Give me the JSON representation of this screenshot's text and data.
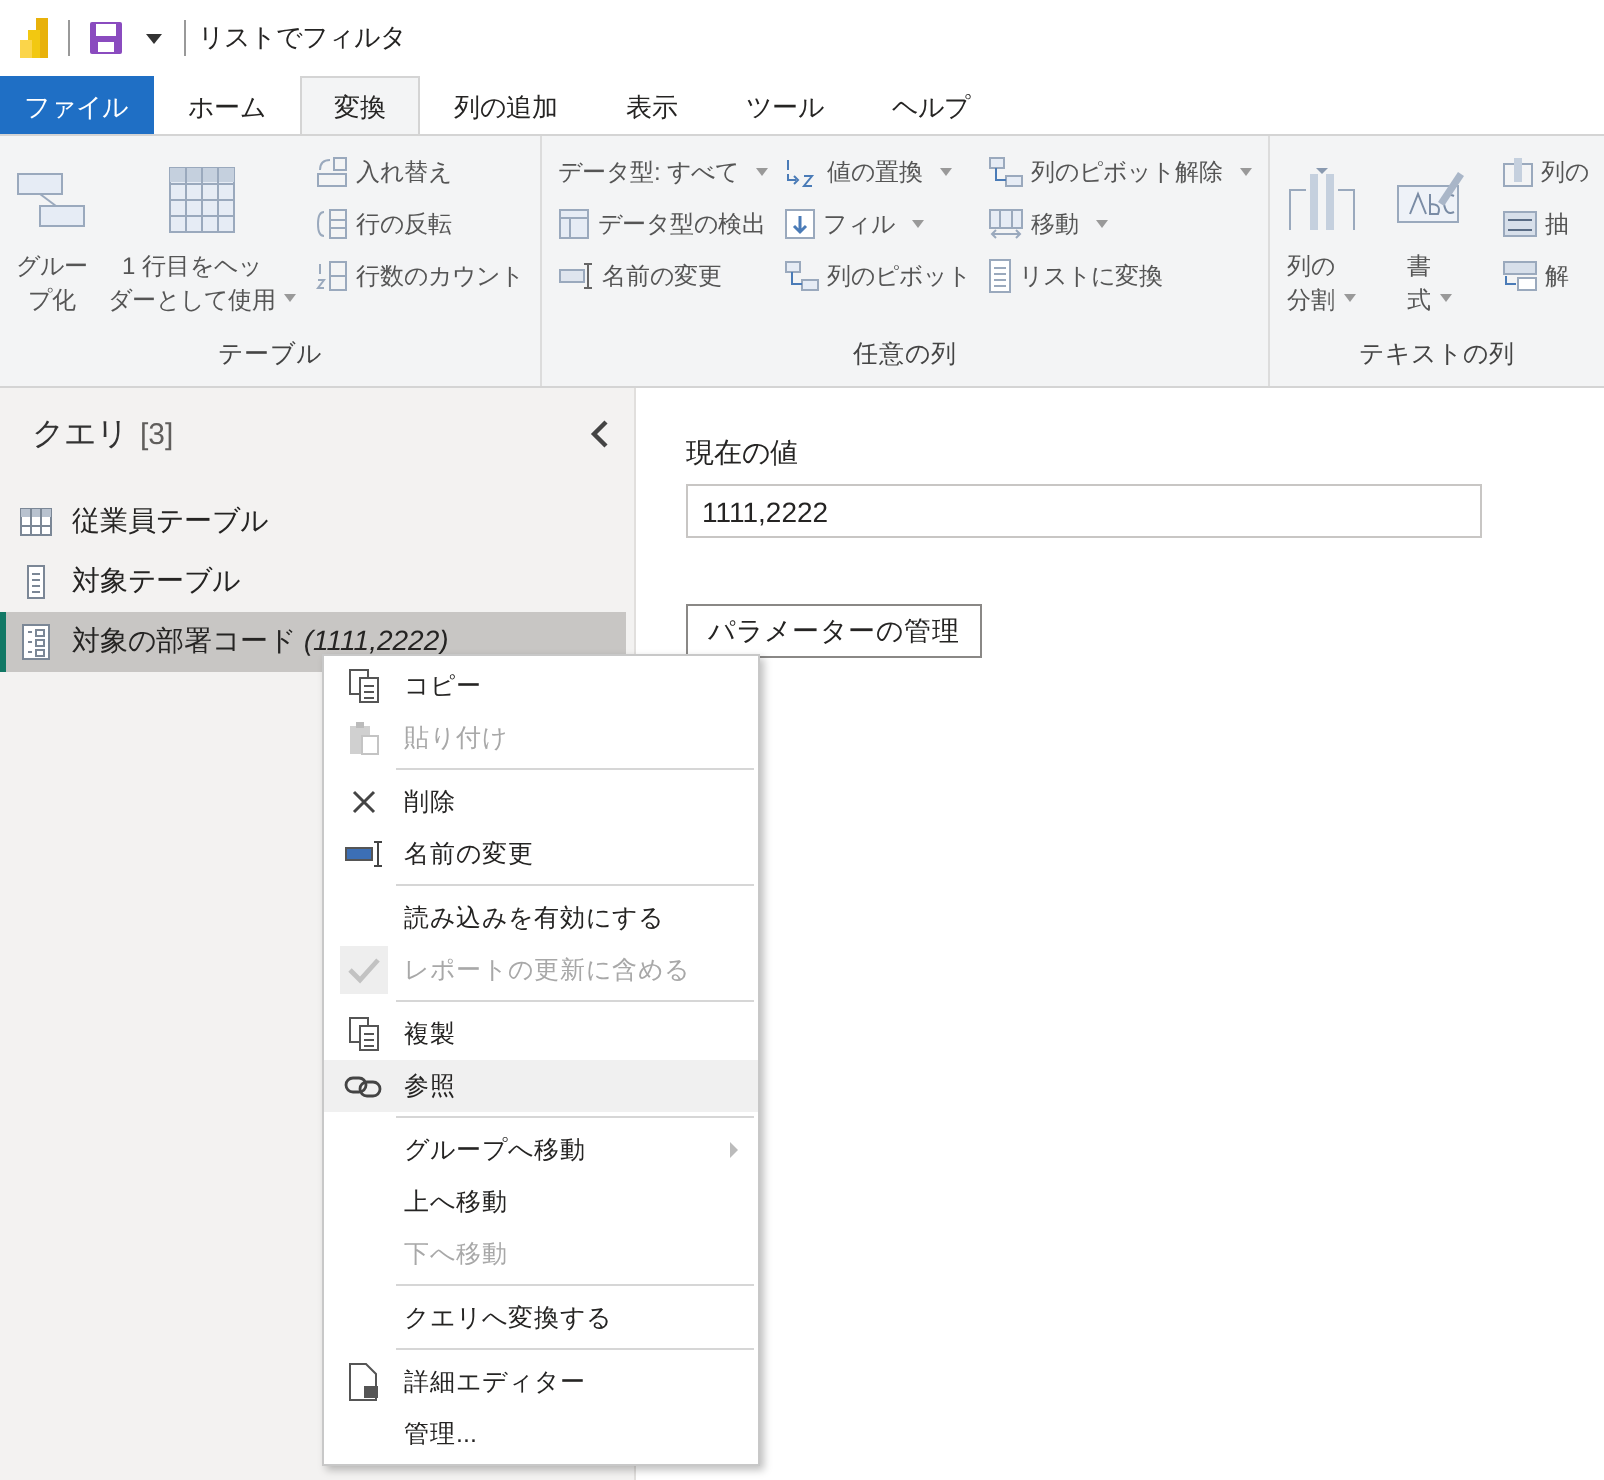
{
  "window": {
    "title": "リストでフィルタ"
  },
  "tabs": [
    {
      "label": "ファイル",
      "kind": "file",
      "selected": false
    },
    {
      "label": "ホーム",
      "kind": "tab",
      "selected": false
    },
    {
      "label": "変換",
      "kind": "tab",
      "selected": true
    },
    {
      "label": "列の追加",
      "kind": "tab",
      "selected": false
    },
    {
      "label": "表示",
      "kind": "tab",
      "selected": false
    },
    {
      "label": "ツール",
      "kind": "tab",
      "selected": false
    },
    {
      "label": "ヘルプ",
      "kind": "tab",
      "selected": false
    }
  ],
  "ribbon": {
    "groups": [
      {
        "label": "テーブル",
        "commands": [
          {
            "lines": [
              "グルー",
              "プ化"
            ],
            "kind": "large",
            "dropdown": false
          },
          {
            "lines": [
              "1 行目をヘッ",
              "ダーとして使用"
            ],
            "kind": "large",
            "dropdown": true
          },
          {
            "label": "入れ替え",
            "kind": "small",
            "dropdown": false
          },
          {
            "label": "行の反転",
            "kind": "small",
            "dropdown": false
          },
          {
            "label": "行数のカウント",
            "kind": "small",
            "dropdown": false
          }
        ]
      },
      {
        "label": "任意の列",
        "commands": [
          {
            "label": "データ型: すべて",
            "kind": "small",
            "dropdown": true
          },
          {
            "label": "データ型の検出",
            "kind": "small",
            "dropdown": false
          },
          {
            "label": "名前の変更",
            "kind": "small",
            "dropdown": false
          },
          {
            "label": "値の置換",
            "kind": "small",
            "dropdown": true
          },
          {
            "label": "フィル",
            "kind": "small",
            "dropdown": true
          },
          {
            "label": "列のピボット",
            "kind": "small",
            "dropdown": false
          },
          {
            "label": "列のピボット解除",
            "kind": "small",
            "dropdown": true
          },
          {
            "label": "移動",
            "kind": "small",
            "dropdown": true
          },
          {
            "label": "リストに変換",
            "kind": "small",
            "dropdown": false
          }
        ]
      },
      {
        "label": "テキストの列",
        "commands": [
          {
            "lines": [
              "列の",
              "分割"
            ],
            "kind": "large",
            "dropdown": true
          },
          {
            "lines": [
              "書",
              "式"
            ],
            "kind": "large",
            "dropdown": true
          },
          {
            "label": "列の",
            "kind": "small",
            "dropdown": false
          },
          {
            "label": "抽",
            "kind": "small",
            "dropdown": false
          },
          {
            "label": "解",
            "kind": "small",
            "dropdown": false
          }
        ]
      }
    ]
  },
  "queries": {
    "title": "クエリ",
    "count": "[3]",
    "items": [
      {
        "label": "従業員テーブル",
        "kind": "table",
        "selected": false
      },
      {
        "label": "対象テーブル",
        "kind": "list",
        "selected": false
      },
      {
        "label": "対象の部署コード *(1111,2222)*",
        "kind": "parameter",
        "selected": true
      }
    ]
  },
  "parameter": {
    "label": "現在の値",
    "value": "1111,2222",
    "button": "パラメーターの管理"
  },
  "context_menu": {
    "groups": [
      [
        {
          "label": "コピー",
          "disabled": false,
          "checked": false,
          "hovered": false,
          "submenu": false
        },
        {
          "label": "貼り付け",
          "disabled": true,
          "checked": false,
          "hovered": false,
          "submenu": false
        }
      ],
      [
        {
          "label": "削除",
          "disabled": false,
          "checked": false,
          "hovered": false,
          "submenu": false
        },
        {
          "label": "名前の変更",
          "disabled": false,
          "checked": false,
          "hovered": false,
          "submenu": false
        }
      ],
      [
        {
          "label": "読み込みを有効にする",
          "disabled": false,
          "checked": false,
          "hovered": false,
          "submenu": false
        },
        {
          "label": "レポートの更新に含める",
          "disabled": true,
          "checked": true,
          "hovered": false,
          "submenu": false
        }
      ],
      [
        {
          "label": "複製",
          "disabled": false,
          "checked": false,
          "hovered": false,
          "submenu": false
        },
        {
          "label": "参照",
          "disabled": false,
          "checked": false,
          "hovered": true,
          "submenu": false
        }
      ],
      [
        {
          "label": "グループへ移動",
          "disabled": false,
          "checked": false,
          "hovered": false,
          "submenu": true
        },
        {
          "label": "上へ移動",
          "disabled": false,
          "checked": false,
          "hovered": false,
          "submenu": false
        },
        {
          "label": "下へ移動",
          "disabled": true,
          "checked": false,
          "hovered": false,
          "submenu": false
        }
      ],
      [
        {
          "label": "クエリへ変換する",
          "disabled": false,
          "checked": false,
          "hovered": false,
          "submenu": false
        }
      ],
      [
        {
          "label": "詳細エディター",
          "disabled": false,
          "checked": false,
          "hovered": false,
          "submenu": false
        },
        {
          "label": "管理...",
          "disabled": false,
          "checked": false,
          "hovered": false,
          "submenu": false
        }
      ]
    ]
  }
}
